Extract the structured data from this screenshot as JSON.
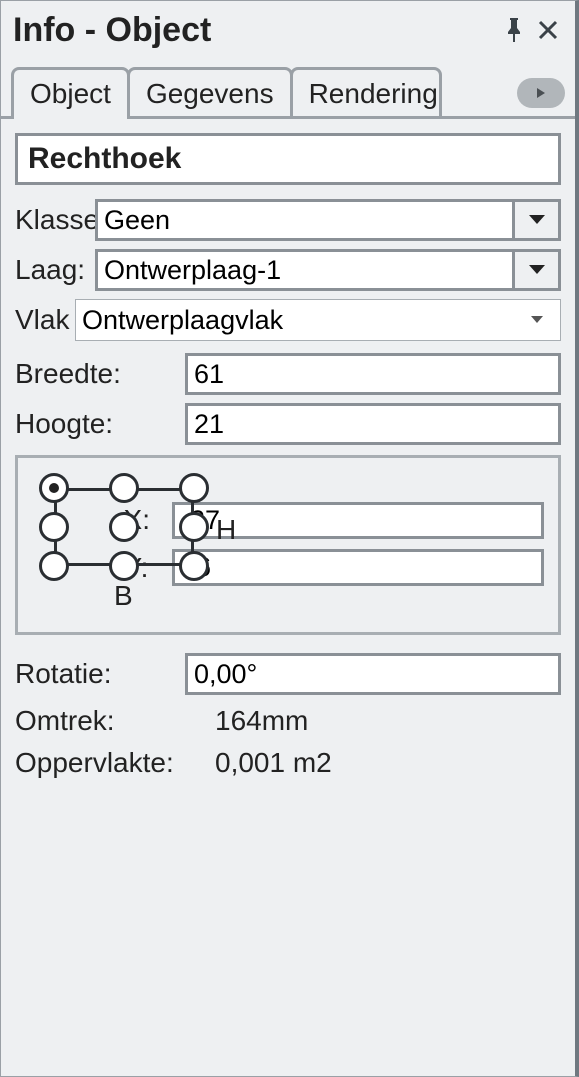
{
  "panel": {
    "title": "Info - Object"
  },
  "tabs": {
    "items": [
      {
        "label": "Object"
      },
      {
        "label": "Gegevens"
      },
      {
        "label": "Rendering"
      }
    ]
  },
  "shape": {
    "name": "Rechthoek"
  },
  "klasse": {
    "label": "Klasse",
    "value": "Geen"
  },
  "laag": {
    "label": "Laag:",
    "value": "Ontwerplaag-1"
  },
  "vlak": {
    "label": "Vlak",
    "value": "Ontwerplaagvlak"
  },
  "breedte": {
    "label": "Breedte:",
    "value": "61"
  },
  "hoogte": {
    "label": "Hoogte:",
    "value": "21"
  },
  "anchor": {
    "h_label": "H",
    "b_label": "B"
  },
  "pos": {
    "x_label": "X:",
    "y_label": "Y:",
    "x": "-27",
    "y": "36"
  },
  "rotatie": {
    "label": "Rotatie:",
    "value": "0,00°"
  },
  "omtrek": {
    "label": "Omtrek:",
    "value": "164mm"
  },
  "oppervlakte": {
    "label": "Oppervlakte:",
    "value": "0,001 m2"
  }
}
